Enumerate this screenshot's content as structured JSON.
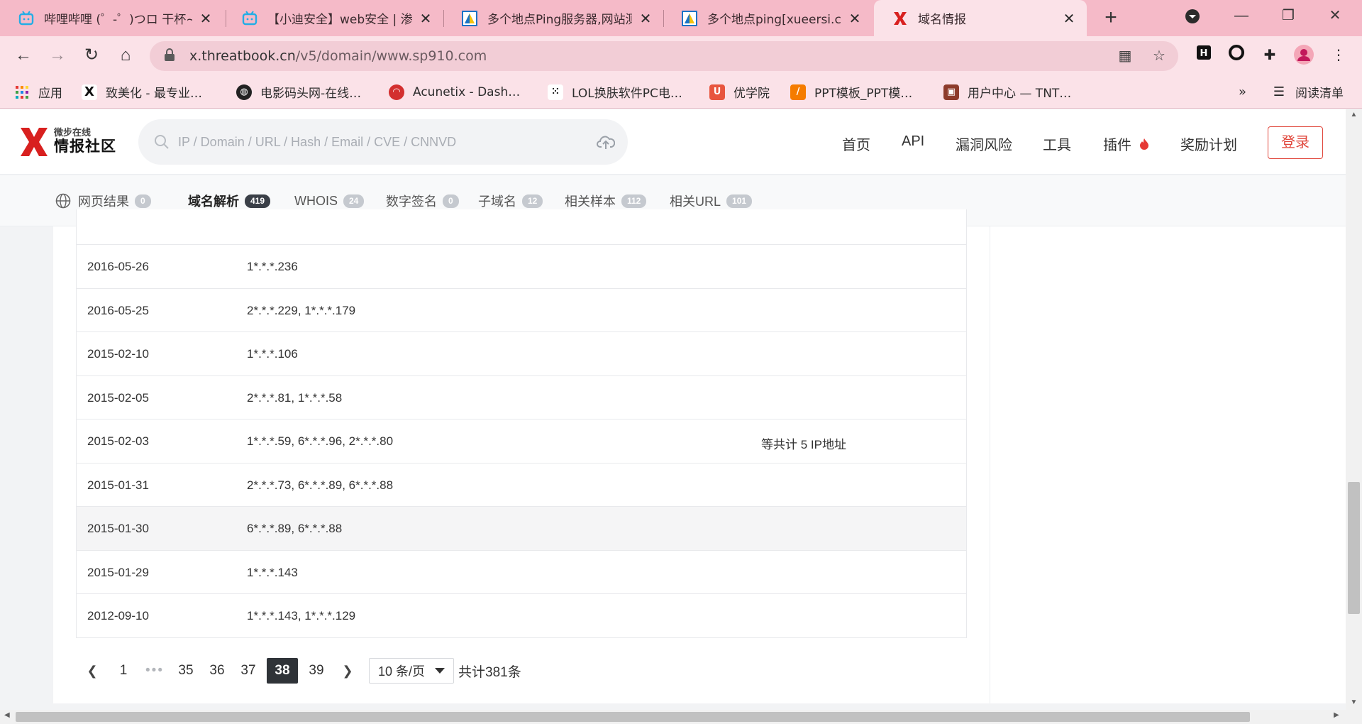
{
  "browser": {
    "tabs": [
      {
        "title": "哔哩哔哩 (゜-゜)つロ 干杯~-bilibili",
        "icon": "bilibili-icon",
        "color": "#23ade5"
      },
      {
        "title": "【小迪安全】web安全 | 渗透测试",
        "icon": "bilibili-icon",
        "color": "#23ade5"
      },
      {
        "title": "多个地点Ping服务器,网站测速",
        "icon": "chinaz-icon",
        "color": "#1a73c8"
      },
      {
        "title": "多个地点ping[xueersi.com]",
        "icon": "chinaz-icon",
        "color": "#1a73c8"
      },
      {
        "title": "域名情报",
        "icon": "threatbook-icon",
        "color": "#d8201f"
      }
    ],
    "address": {
      "host": "x.threatbook.cn",
      "path": "/v5/domain/www.sp910.com"
    },
    "bookmarks": [
      {
        "label": "应用",
        "icon": "apps-grid-icon"
      },
      {
        "label": "致美化 - 最专业…",
        "icon": "zhimeihua-icon"
      },
      {
        "label": "电影码头网-在线…",
        "icon": "globe-icon"
      },
      {
        "label": "Acunetix - Dash…",
        "icon": "acunetix-icon"
      },
      {
        "label": "LOL换肤软件PC电…",
        "icon": "lol-icon"
      },
      {
        "label": "优学院",
        "icon": "ulearning-icon"
      },
      {
        "label": "PPT模板_PPT模…",
        "icon": "ppt-icon"
      },
      {
        "label": "用户中心 — TNT…",
        "icon": "tnt-icon"
      }
    ],
    "reading_list": "阅读清单",
    "more_bookmarks": "»"
  },
  "site": {
    "logo_sub": "微步在线",
    "logo_main": "情报社区",
    "search_placeholder": "IP / Domain / URL / Hash / Email / CVE / CNNVD",
    "nav": [
      "首页",
      "API",
      "漏洞风险",
      "工具",
      "插件",
      "奖励计划"
    ],
    "login": "登录"
  },
  "subtabs": [
    {
      "label": "网页结果",
      "count": "0"
    },
    {
      "label": "域名解析",
      "count": "419"
    },
    {
      "label": "WHOIS",
      "count": "24"
    },
    {
      "label": "数字签名",
      "count": "0"
    },
    {
      "label": "子域名",
      "count": "12"
    },
    {
      "label": "相关样本",
      "count": "112"
    },
    {
      "label": "相关URL",
      "count": "101"
    }
  ],
  "dns_records": [
    {
      "date": "2016-05-26",
      "ips": "1*.*.*.236",
      "more": ""
    },
    {
      "date": "2016-05-25",
      "ips": "2*.*.*.229, 1*.*.*.179",
      "more": ""
    },
    {
      "date": "2015-02-10",
      "ips": "1*.*.*.106",
      "more": ""
    },
    {
      "date": "2015-02-05",
      "ips": "2*.*.*.81, 1*.*.*.58",
      "more": ""
    },
    {
      "date": "2015-02-03",
      "ips": "1*.*.*.59, 6*.*.*.96, 2*.*.*.80",
      "more": "等共计 5 IP地址"
    },
    {
      "date": "2015-01-31",
      "ips": "2*.*.*.73, 6*.*.*.89, 6*.*.*.88",
      "more": ""
    },
    {
      "date": "2015-01-30",
      "ips": "6*.*.*.89, 6*.*.*.88",
      "more": ""
    },
    {
      "date": "2015-01-29",
      "ips": "1*.*.*.143",
      "more": ""
    },
    {
      "date": "2012-09-10",
      "ips": "1*.*.*.143, 1*.*.*.129",
      "more": ""
    }
  ],
  "pagination": {
    "first": "1",
    "ellipsis": "•••",
    "pages": [
      "35",
      "36",
      "37",
      "38",
      "39"
    ],
    "current": "38",
    "page_size": "10 条/页",
    "total": "共计381条"
  }
}
